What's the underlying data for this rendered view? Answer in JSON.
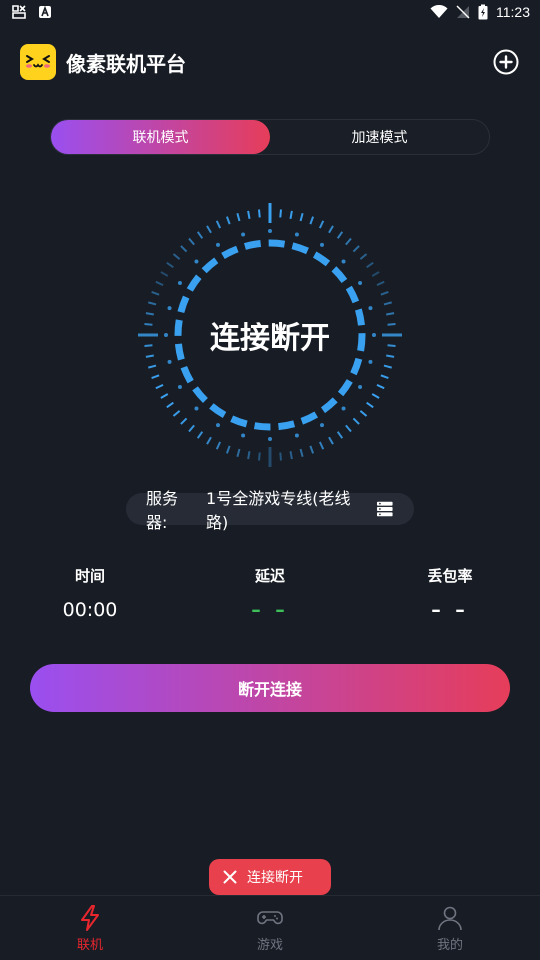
{
  "status_bar": {
    "time": "11:23",
    "left_icons": [
      "bug-icon",
      "a-notification-icon"
    ],
    "right_icons": [
      "wifi-icon",
      "no-signal-icon",
      "battery-charging-icon"
    ]
  },
  "header": {
    "title": "像素联机平台",
    "logo_icon": "smiley-face-logo",
    "action_icon": "add-circle-icon"
  },
  "mode_tabs": [
    {
      "label": "联机模式",
      "active": true
    },
    {
      "label": "加速模式",
      "active": false
    }
  ],
  "dial": {
    "status_text": "连接断开",
    "accent_color": "#3aa1f0"
  },
  "server": {
    "label": "服务器:",
    "name": "1号全游戏专线(老线路)",
    "icon": "server-list-icon"
  },
  "stats": {
    "time": {
      "label": "时间",
      "value": "00:00"
    },
    "latency": {
      "label": "延迟",
      "value": "– –"
    },
    "packet_loss": {
      "label": "丢包率",
      "value": "– –"
    }
  },
  "action_button": {
    "label": "断开连接"
  },
  "toast": {
    "icon": "close-icon",
    "text": "连接断开"
  },
  "bottom_nav": [
    {
      "label": "联机",
      "icon": "lightning-icon",
      "active": true
    },
    {
      "label": "游戏",
      "icon": "gamepad-icon",
      "active": false
    },
    {
      "label": "我的",
      "icon": "user-icon",
      "active": false
    }
  ],
  "colors": {
    "background": "#181c24",
    "gradient_start": "#9a4ff0",
    "gradient_end": "#e63d5a",
    "dial_blue": "#3aa1f0",
    "latency_green": "#3cc05a",
    "toast_red": "#e8404c",
    "nav_active": "#e8262e"
  }
}
